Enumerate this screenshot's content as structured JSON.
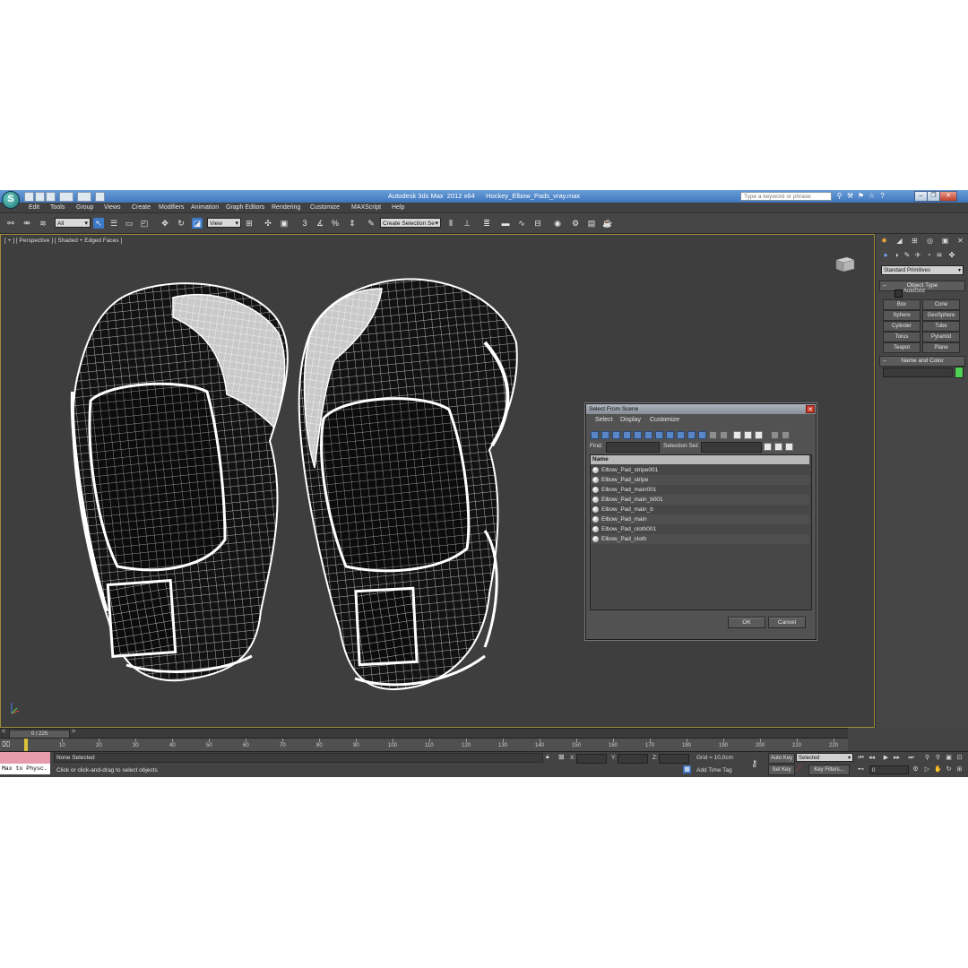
{
  "window": {
    "title": "Autodesk 3ds Max  2012 x64      Hockey_Elbow_Pads_vray.max",
    "search_placeholder": "Type a keyword or phrase",
    "controls": [
      "minimize-icon",
      "restore-icon",
      "close-icon"
    ]
  },
  "menu": [
    "Edit",
    "Tools",
    "Group",
    "Views",
    "Create",
    "Modifiers",
    "Animation",
    "Graph Editors",
    "Rendering",
    "Customize",
    "MAXScript",
    "Help"
  ],
  "toolbar": {
    "filter_value": "All",
    "refcoord_value": "View",
    "selection_set_placeholder": "Create Selection Se",
    "percent_snap_label": "%"
  },
  "viewport": {
    "label": "[ + ] [ Perspective ] [ Shaded + Edged Faces ]",
    "wire_color": "#ffffff",
    "object_color": "#111111",
    "background_color": "#3e3e3e"
  },
  "dialog": {
    "title": "Select From Scene",
    "menu": [
      "Select",
      "Display",
      "Customize"
    ],
    "find_label": "Find:",
    "selection_set_label": "Selection Set:",
    "column_header": "Name",
    "items": [
      "Elbow_Pad_stripe001",
      "Elbow_Pad_stripe",
      "Elbow_Pad_main001",
      "Elbow_Pad_main_b001",
      "Elbow_Pad_main_b",
      "Elbow_Pad_main",
      "Elbow_Pad_cloth001",
      "Elbow_Pad_cloth"
    ],
    "ok_label": "OK",
    "cancel_label": "Cancel"
  },
  "command_panel": {
    "category_value": "Standard Primitives",
    "object_type_title": "Object Type",
    "autogrid_label": "AutoGrid",
    "primitives": [
      "Box",
      "Cone",
      "Sphere",
      "GeoSphere",
      "Cylinder",
      "Tube",
      "Torus",
      "Pyramid",
      "Teapot",
      "Plane"
    ],
    "name_color_title": "Name and Color",
    "object_color": "#4fd154"
  },
  "timeline": {
    "frame_display": "0 / 225",
    "ticks": [
      "10",
      "20",
      "30",
      "40",
      "50",
      "60",
      "70",
      "80",
      "90",
      "100",
      "110",
      "120",
      "130",
      "140",
      "150",
      "160",
      "170",
      "180",
      "190",
      "200",
      "210",
      "220"
    ]
  },
  "status": {
    "maxscript_text": "Max to Physc.",
    "selection_text": "None Selected",
    "prompt_text": "Click or click-and-drag to select objects",
    "x_label": "X:",
    "y_label": "Y:",
    "z_label": "Z:",
    "grid_text": "Grid = 10,0cm",
    "add_time_tag": "Add Time Tag",
    "auto_key": "Auto Key",
    "set_key": "Set Key",
    "key_mode_value": "Selected",
    "key_filters": "Key Filters...",
    "current_frame": "0"
  }
}
